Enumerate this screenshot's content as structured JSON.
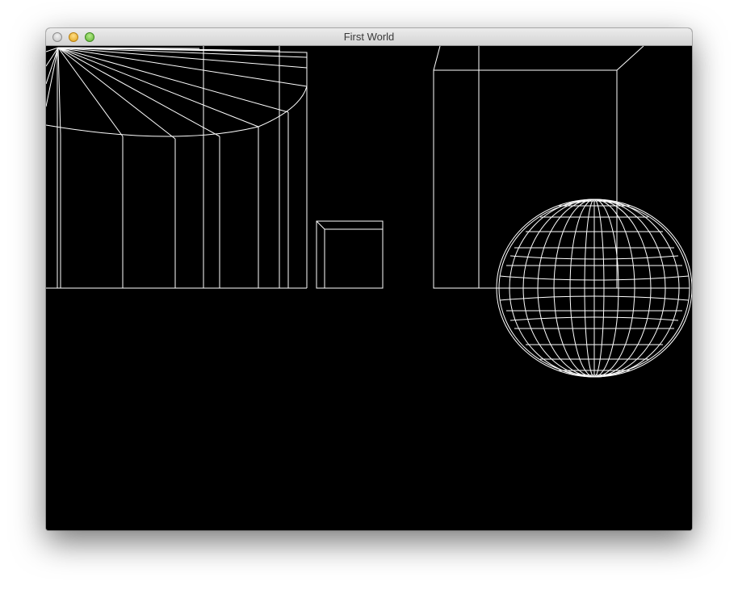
{
  "window": {
    "title": "First World"
  },
  "scene": {
    "background_color": "#000000",
    "wire_color": "#ffffff",
    "objects": [
      "cylinder-wireframe",
      "box-wireframe",
      "box-wireframe",
      "sphere-wireframe"
    ]
  }
}
